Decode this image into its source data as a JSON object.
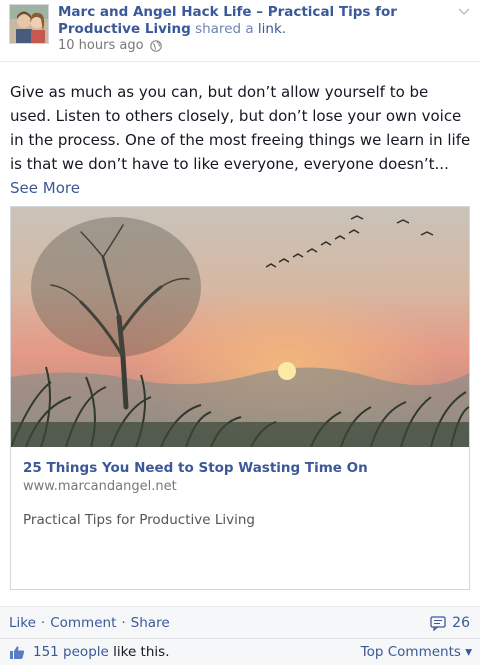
{
  "post": {
    "author": "Marc and Angel Hack Life – Practical Tips for Productive Living",
    "shared_text": " shared a ",
    "shared_link": "link.",
    "timestamp": "10 hours ago",
    "message": "Give as much as you can, but don’t allow yourself to be used. Listen to others closely, but don’t lose your own voice in the process. One of the most freeing things we learn in life is that we don’t have to like everyone, everyone doesn’t... ",
    "see_more": "See More"
  },
  "card": {
    "title": "25 Things You Need to Stop Wasting Time On",
    "domain": "www.marcandangel.net",
    "description": "Practical Tips for Productive Living"
  },
  "actions": {
    "like": "Like",
    "comment": "Comment",
    "share": "Share",
    "separator": "·",
    "comment_count": "26"
  },
  "likes": {
    "count_people": "151 people",
    "like_suffix": " like this.",
    "top_comments": "Top Comments ▾"
  },
  "icons": {
    "avatar": "profile-photo",
    "globe": "globe-icon",
    "chevron": "chevron-down-icon",
    "comment": "comment-icon",
    "like": "thumbs-up-icon"
  },
  "colors": {
    "link_blue": "#3b5998",
    "meta_gray": "#777777",
    "bar_bg": "#f6f7f8"
  }
}
